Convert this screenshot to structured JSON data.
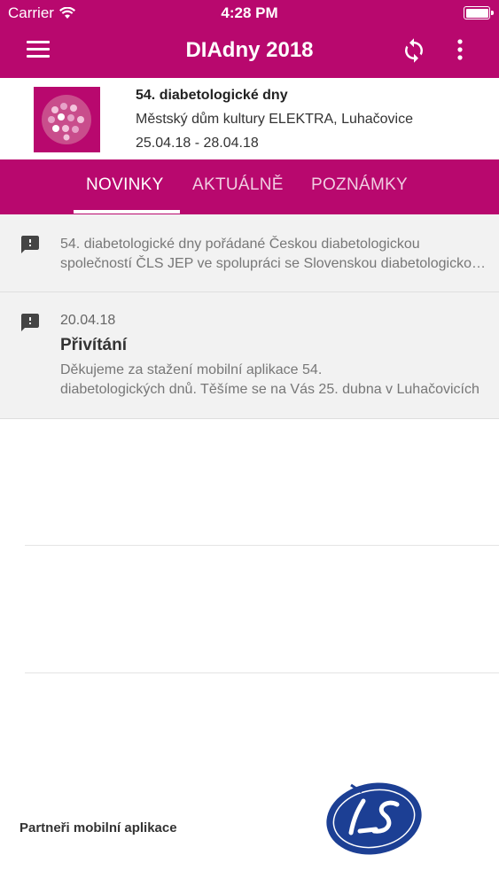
{
  "status_bar": {
    "carrier": "Carrier",
    "time": "4:28 PM"
  },
  "app_bar": {
    "title": "DIAdny 2018"
  },
  "event": {
    "name": "54. diabetologické dny",
    "venue": "Městský dům kultury ELEKTRA, Luhačovice",
    "dates": "25.04.18 - 28.04.18"
  },
  "tabs": [
    {
      "label": "NOVINKY",
      "active": true
    },
    {
      "label": "AKTUÁLNĚ",
      "active": false
    },
    {
      "label": "POZNÁMKY",
      "active": false
    }
  ],
  "news": [
    {
      "line1": "54. diabetologické dny pořádané Českou diabetologickou",
      "line2": "společností ČLS JEP ve spolupráci se Slovenskou diabetologickou společností"
    },
    {
      "date": "20.04.18",
      "title": "Přivítání",
      "line1": "Děkujeme za stažení mobilní aplikace 54.",
      "line2": "diabetologických dnů. Těšíme se na Vás 25. dubna v Luhačovicích"
    }
  ],
  "partners": {
    "label": "Partneři mobilní aplikace"
  },
  "colors": {
    "brand": "#b8086e",
    "feed_bg": "#f2f2f2",
    "partner_blue": "#1c3f94"
  }
}
